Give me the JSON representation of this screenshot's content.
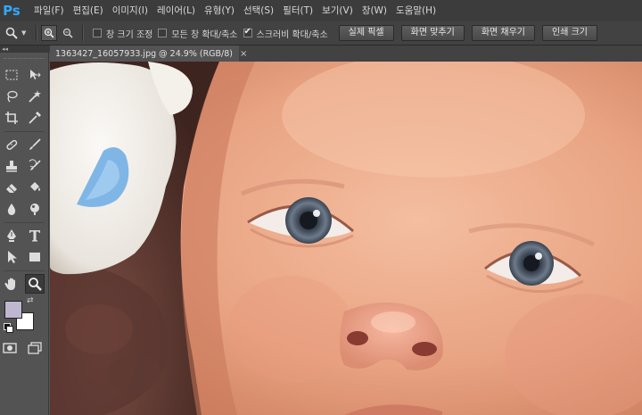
{
  "app": {
    "logo": "Ps"
  },
  "menu": [
    "파일(F)",
    "편집(E)",
    "이미지(I)",
    "레이어(L)",
    "유형(Y)",
    "선택(S)",
    "필터(T)",
    "보기(V)",
    "창(W)",
    "도움말(H)"
  ],
  "options": {
    "resize_windows": {
      "label": "창 크기 조정",
      "checked": false
    },
    "zoom_all_windows": {
      "label": "모든 창 확대/축소",
      "checked": false
    },
    "scrubby_zoom": {
      "label": "스크러비 확대/축소",
      "checked": true
    },
    "buttons": [
      "실제 픽셀",
      "화면 맞추기",
      "화면 채우기",
      "인쇄 크기"
    ]
  },
  "document": {
    "tab_title": "1363427_16057933.jpg @ 24.9% (RGB/8)",
    "close_symbol": "×"
  },
  "colors": {
    "foreground": "#bfb6d0",
    "background": "#ffffff",
    "accent": "#31a8ff"
  },
  "tools": [
    "rectangular-marquee",
    "move",
    "lasso",
    "magic-wand",
    "crop",
    "eyedropper",
    "spot-healing-brush",
    "brush",
    "clone-stamp",
    "history-brush",
    "eraser",
    "paint-bucket",
    "blur",
    "dodge",
    "pen",
    "type",
    "path-selection",
    "rectangle",
    "hand",
    "zoom"
  ]
}
